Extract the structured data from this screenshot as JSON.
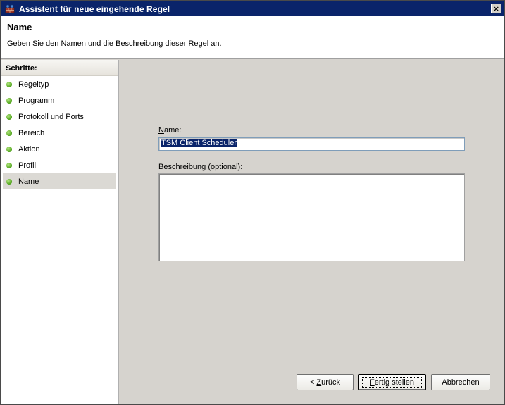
{
  "window": {
    "title": "Assistent für neue eingehende Regel",
    "close_label": "×"
  },
  "header": {
    "title": "Name",
    "description": "Geben Sie den Namen und die Beschreibung dieser Regel an."
  },
  "sidebar": {
    "heading": "Schritte:",
    "items": [
      {
        "label": "Regeltyp"
      },
      {
        "label": "Programm"
      },
      {
        "label": "Protokoll und Ports"
      },
      {
        "label": "Bereich"
      },
      {
        "label": "Aktion"
      },
      {
        "label": "Profil"
      },
      {
        "label": "Name",
        "active": true
      }
    ]
  },
  "form": {
    "name_label_accel": "N",
    "name_label_rest": "ame:",
    "name_value": "TSM Client Scheduler",
    "desc_label_pre": "Be",
    "desc_label_accel": "s",
    "desc_label_rest": "chreibung (optional):",
    "desc_value": ""
  },
  "buttons": {
    "back_prefix": "< ",
    "back_accel": "Z",
    "back_rest": "urück",
    "finish_accel": "F",
    "finish_rest": "ertig stellen",
    "cancel": "Abbrechen"
  }
}
